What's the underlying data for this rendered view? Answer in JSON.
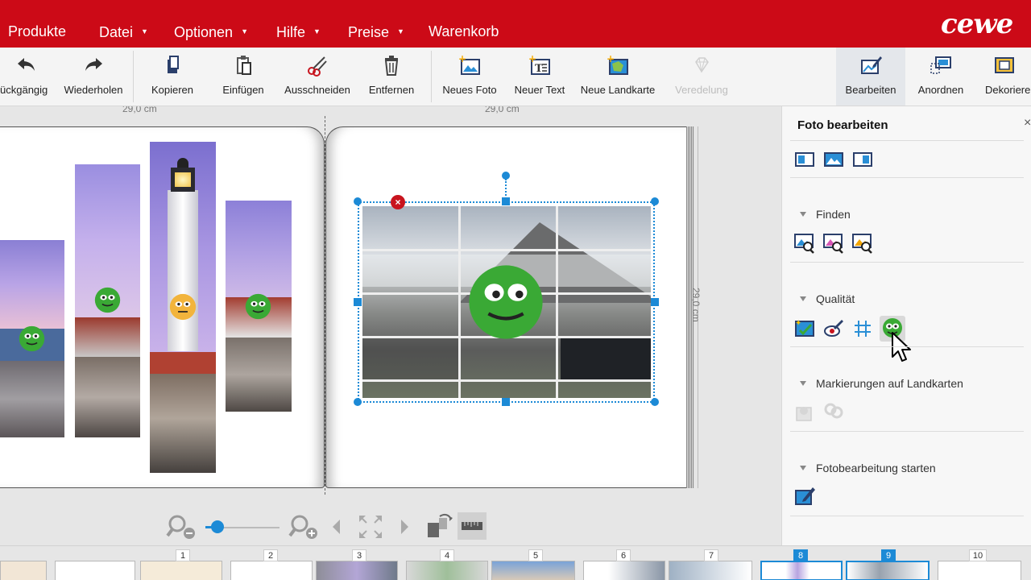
{
  "menu": {
    "items": [
      {
        "label": "Produkte",
        "has_caret": false
      },
      {
        "label": "Datei",
        "has_caret": true
      },
      {
        "label": "Optionen",
        "has_caret": true
      },
      {
        "label": "Hilfe",
        "has_caret": true
      },
      {
        "label": "Preise",
        "has_caret": true
      },
      {
        "label": "Warenkorb",
        "has_caret": false
      }
    ],
    "logo": "cewe",
    "brand_color": "#cc0a17"
  },
  "toolbar": {
    "undo": "ückgängig",
    "redo": "Wiederholen",
    "copy": "Kopieren",
    "paste": "Einfügen",
    "cut": "Ausschneiden",
    "remove": "Entfernen",
    "new_photo": "Neues Foto",
    "new_text": "Neuer Text",
    "new_map": "Neue Landkarte",
    "refinement": "Veredelung",
    "edit": "Bearbeiten",
    "arrange": "Anordnen",
    "decorate": "Dekoriere"
  },
  "workspace": {
    "ruler_left": "29,0 cm",
    "ruler_right": "29,0 cm",
    "height_label": "29,0 cm",
    "accent_color": "#1c8ad6"
  },
  "panel": {
    "title": "Foto bearbeiten",
    "close": "×",
    "sections": {
      "find": "Finden",
      "quality": "Qualität",
      "map_markers": "Markierungen auf Landkarten",
      "start_editing": "Fotobearbeitung starten"
    }
  },
  "filmstrip": {
    "page_numbers": [
      "1",
      "2",
      "3",
      "4",
      "5",
      "6",
      "7",
      "8",
      "9",
      "10"
    ],
    "selected_pages": [
      "8",
      "9"
    ]
  }
}
